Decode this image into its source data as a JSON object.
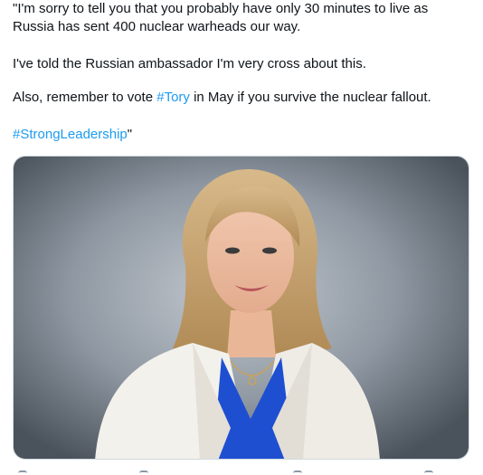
{
  "tweet": {
    "line1": "\"I'm sorry to tell you that you probably have only 30 minutes to live as Russia has sent 400 nuclear warheads our way.",
    "line2": "I've told the Russian ambassador I'm very cross about this.",
    "line3_before": "Also, remember to vote ",
    "line3_hashtag": "#Tory",
    "line3_after": " in May if you survive the nuclear fallout.",
    "line4_hashtag": "#StrongLeadership",
    "line4_after": "\""
  },
  "colors": {
    "text": "#0f1419",
    "link": "#1d9bf0",
    "media_border": "#cfd9de",
    "backdrop": "#9aa3ad",
    "blazer": "#f3f1ec",
    "top": "#1f4fd1",
    "hair": "#c9a46a"
  },
  "icons": {
    "action_bar": [
      "reply-icon",
      "retweet-icon",
      "like-icon",
      "share-icon"
    ]
  }
}
